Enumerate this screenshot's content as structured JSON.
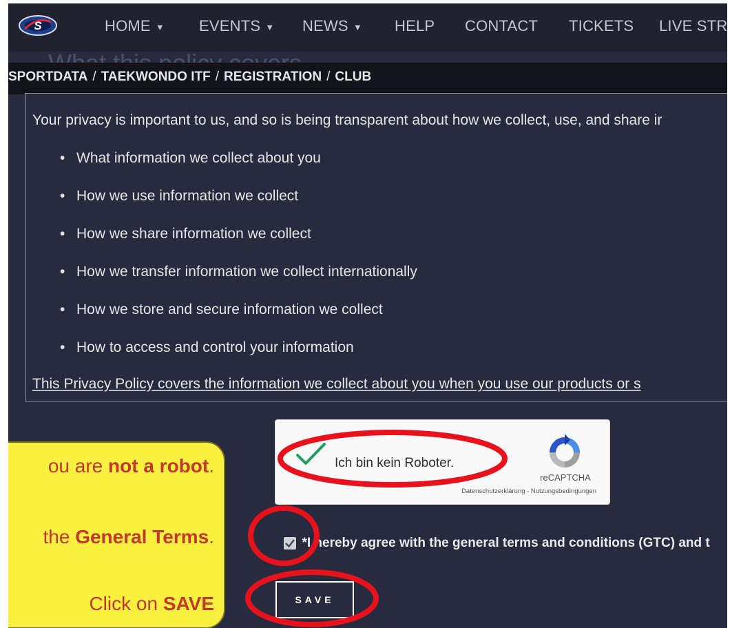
{
  "nav": {
    "items": [
      {
        "label": "HOME",
        "dropdown": true
      },
      {
        "label": "EVENTS",
        "dropdown": true
      },
      {
        "label": "NEWS",
        "dropdown": true
      },
      {
        "label": "HELP",
        "dropdown": false
      },
      {
        "label": "CONTACT",
        "dropdown": false
      },
      {
        "label": "TICKETS",
        "dropdown": false
      },
      {
        "label": "LIVE STREA",
        "dropdown": false
      }
    ]
  },
  "breadcrumb": [
    "SPORTDATA",
    "TAEKWONDO ITF",
    "REGISTRATION",
    "CLUB"
  ],
  "policy": {
    "heading": "What this policy covers",
    "intro": "Your privacy is important to us, and so is being transparent about how we collect, use, and share ir",
    "items": [
      "What information we collect about you",
      "How we use information we collect",
      "How we share information we collect",
      "How we transfer information we collect internationally",
      "How we store and secure information we collect",
      "How to access and control your information"
    ],
    "footer": "This Privacy Policy covers the information we collect about you when you use our products or s"
  },
  "captcha": {
    "label": "Ich bin kein Roboter.",
    "brand": "reCAPTCHA",
    "links": "Datenschutzerklärung - Nutzungsbedingungen",
    "checked": true
  },
  "agree": {
    "text": "*I hereby agree with the general terms and conditions (GTC) and t",
    "checked": true
  },
  "save_label": "SAVE",
  "callout": {
    "line1_pre": "ou are ",
    "line1_bold": "not a robot",
    "line1_post": ".",
    "line2_pre": "the ",
    "line2_bold": "General Terms",
    "line2_post": ".",
    "line3_pre": "Click on ",
    "line3_bold": "SAVE"
  },
  "colors": {
    "page_bg": "#272b3d",
    "nav_bg": "#20232f",
    "breadcrumb_bg": "#121419",
    "callout_bg": "#fbef3f",
    "callout_text": "#c0392b",
    "annotation_red": "#e8121d",
    "checkmark_green": "#1f9e5a"
  }
}
